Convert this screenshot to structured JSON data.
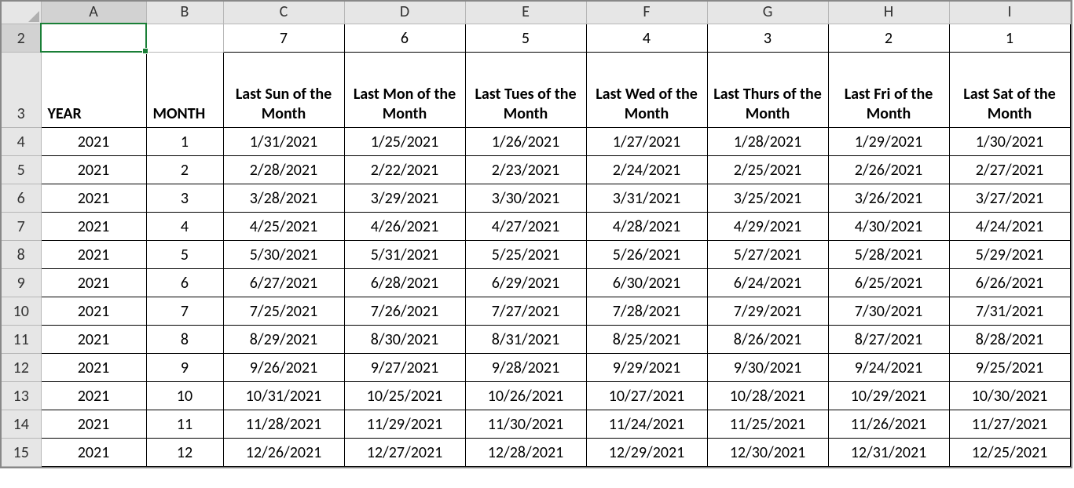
{
  "columns": [
    "A",
    "B",
    "C",
    "D",
    "E",
    "F",
    "G",
    "H",
    "I"
  ],
  "row_numbers": [
    "2",
    "3",
    "4",
    "5",
    "6",
    "7",
    "8",
    "9",
    "10",
    "11",
    "12",
    "13",
    "14",
    "15"
  ],
  "active_col": "A",
  "active_row": "2",
  "row2": {
    "C": "7",
    "D": "6",
    "E": "5",
    "F": "4",
    "G": "3",
    "H": "2",
    "I": "1"
  },
  "row3": {
    "A": "YEAR",
    "B": "MONTH",
    "C": "Last Sun of the Month",
    "D": "Last Mon of the Month",
    "E": "Last Tues of the Month",
    "F": "Last Wed of the Month",
    "G": "Last Thurs of the Month",
    "H": "Last Fri of the Month",
    "I": "Last Sat of the Month"
  },
  "data_rows": [
    {
      "A": "2021",
      "B": "1",
      "C": "1/31/2021",
      "D": "1/25/2021",
      "E": "1/26/2021",
      "F": "1/27/2021",
      "G": "1/28/2021",
      "H": "1/29/2021",
      "I": "1/30/2021"
    },
    {
      "A": "2021",
      "B": "2",
      "C": "2/28/2021",
      "D": "2/22/2021",
      "E": "2/23/2021",
      "F": "2/24/2021",
      "G": "2/25/2021",
      "H": "2/26/2021",
      "I": "2/27/2021"
    },
    {
      "A": "2021",
      "B": "3",
      "C": "3/28/2021",
      "D": "3/29/2021",
      "E": "3/30/2021",
      "F": "3/31/2021",
      "G": "3/25/2021",
      "H": "3/26/2021",
      "I": "3/27/2021"
    },
    {
      "A": "2021",
      "B": "4",
      "C": "4/25/2021",
      "D": "4/26/2021",
      "E": "4/27/2021",
      "F": "4/28/2021",
      "G": "4/29/2021",
      "H": "4/30/2021",
      "I": "4/24/2021"
    },
    {
      "A": "2021",
      "B": "5",
      "C": "5/30/2021",
      "D": "5/31/2021",
      "E": "5/25/2021",
      "F": "5/26/2021",
      "G": "5/27/2021",
      "H": "5/28/2021",
      "I": "5/29/2021"
    },
    {
      "A": "2021",
      "B": "6",
      "C": "6/27/2021",
      "D": "6/28/2021",
      "E": "6/29/2021",
      "F": "6/30/2021",
      "G": "6/24/2021",
      "H": "6/25/2021",
      "I": "6/26/2021"
    },
    {
      "A": "2021",
      "B": "7",
      "C": "7/25/2021",
      "D": "7/26/2021",
      "E": "7/27/2021",
      "F": "7/28/2021",
      "G": "7/29/2021",
      "H": "7/30/2021",
      "I": "7/31/2021"
    },
    {
      "A": "2021",
      "B": "8",
      "C": "8/29/2021",
      "D": "8/30/2021",
      "E": "8/31/2021",
      "F": "8/25/2021",
      "G": "8/26/2021",
      "H": "8/27/2021",
      "I": "8/28/2021"
    },
    {
      "A": "2021",
      "B": "9",
      "C": "9/26/2021",
      "D": "9/27/2021",
      "E": "9/28/2021",
      "F": "9/29/2021",
      "G": "9/30/2021",
      "H": "9/24/2021",
      "I": "9/25/2021"
    },
    {
      "A": "2021",
      "B": "10",
      "C": "10/31/2021",
      "D": "10/25/2021",
      "E": "10/26/2021",
      "F": "10/27/2021",
      "G": "10/28/2021",
      "H": "10/29/2021",
      "I": "10/30/2021"
    },
    {
      "A": "2021",
      "B": "11",
      "C": "11/28/2021",
      "D": "11/29/2021",
      "E": "11/30/2021",
      "F": "11/24/2021",
      "G": "11/25/2021",
      "H": "11/26/2021",
      "I": "11/27/2021"
    },
    {
      "A": "2021",
      "B": "12",
      "C": "12/26/2021",
      "D": "12/27/2021",
      "E": "12/28/2021",
      "F": "12/29/2021",
      "G": "12/30/2021",
      "H": "12/31/2021",
      "I": "12/25/2021"
    }
  ]
}
